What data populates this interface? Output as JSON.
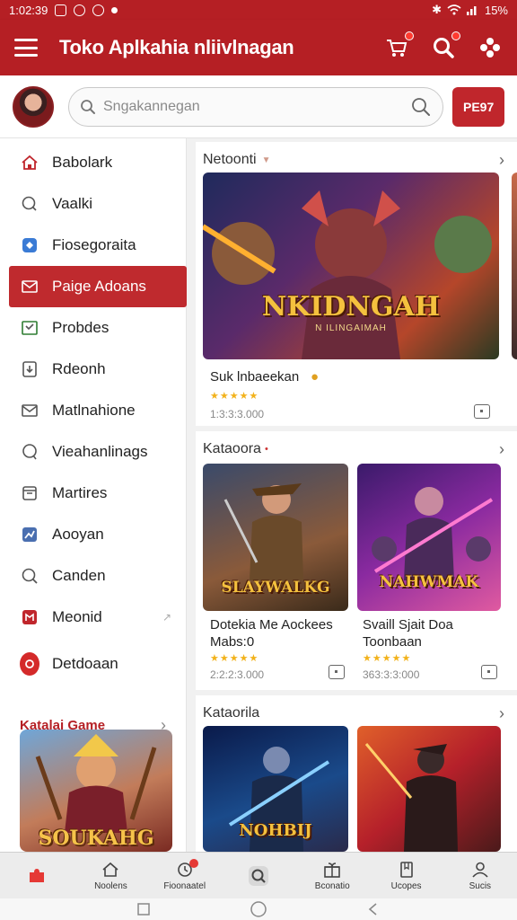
{
  "status_bar": {
    "time": "1:02:39",
    "battery": "15%"
  },
  "app": {
    "title": "Toko Aplkahia nliivlnagan"
  },
  "search": {
    "placeholder": "Sngakannegan",
    "button_label": "PE97"
  },
  "sidebar": {
    "items": [
      {
        "label": "Babolark",
        "icon": "home-icon"
      },
      {
        "label": "Vaalki",
        "icon": "chat-icon"
      },
      {
        "label": "Fiosegoraita",
        "icon": "map-icon"
      },
      {
        "label": "Paige Adoans",
        "icon": "mail-icon",
        "active": true
      },
      {
        "label": "Probdes",
        "icon": "mail-check-icon"
      },
      {
        "label": "Rdeonh",
        "icon": "download-icon"
      },
      {
        "label": "Matlnahione",
        "icon": "envelope-icon"
      },
      {
        "label": "Vieahanlinags",
        "icon": "bubble-icon"
      },
      {
        "label": "Martires",
        "icon": "calendar-icon"
      },
      {
        "label": "Aooyan",
        "icon": "shuffle-icon"
      },
      {
        "label": "Canden",
        "icon": "search-icon"
      },
      {
        "label": "Meonid",
        "icon": "library-icon"
      },
      {
        "label": "Detdoaan",
        "icon": "record-icon"
      }
    ],
    "section_title": "Katalai Game",
    "featured_logo": "SOUKAHG"
  },
  "sections": [
    {
      "title": "Netoonti",
      "games": [
        {
          "name": "Suk lnbaeekan",
          "rating": "★★★★★",
          "meta": "1:3:3:3.000",
          "logo": "NKIDNGAH",
          "sub": "N ILINGAIMAH"
        }
      ]
    },
    {
      "title": "Kataoora",
      "games": [
        {
          "name": "Dotekia Me Aockees Mabs:0",
          "rating": "★★★★★",
          "meta": "2:2:2:3.000",
          "logo": "SLAYWALKG"
        },
        {
          "name": "Svaill Sjait Doa Toonbaan",
          "rating": "★★★★★",
          "meta": "363:3:3:000",
          "logo": "NAHWMAK"
        }
      ]
    },
    {
      "title": "Kataorila",
      "games": [
        {
          "logo": "NOHBIJ"
        },
        {
          "logo": ""
        }
      ]
    }
  ],
  "bottom_nav": [
    {
      "label": "",
      "icon": "puzzle-icon"
    },
    {
      "label": "Noolens",
      "icon": "home-icon"
    },
    {
      "label": "Fioonaatel",
      "icon": "bell-icon"
    },
    {
      "label": "",
      "icon": "search-icon"
    },
    {
      "label": "Bconatio",
      "icon": "gift-icon"
    },
    {
      "label": "Ucopes",
      "icon": "book-icon"
    },
    {
      "label": "Sucis",
      "icon": "person-icon"
    }
  ],
  "colors": {
    "brand": "#b51f24",
    "active_item": "#bf2a2e",
    "star": "#f2b21b"
  }
}
